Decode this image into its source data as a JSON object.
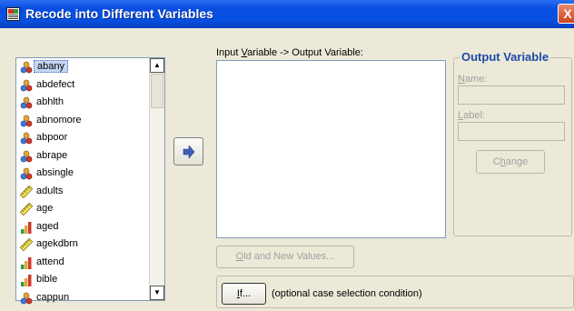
{
  "window": {
    "title": "Recode into Different Variables",
    "close_label": "X"
  },
  "source_list": {
    "items": [
      {
        "name": "abany",
        "type": "nominal",
        "selected": true
      },
      {
        "name": "abdefect",
        "type": "nominal"
      },
      {
        "name": "abhlth",
        "type": "nominal"
      },
      {
        "name": "abnomore",
        "type": "nominal"
      },
      {
        "name": "abpoor",
        "type": "nominal"
      },
      {
        "name": "abrape",
        "type": "nominal"
      },
      {
        "name": "absingle",
        "type": "nominal"
      },
      {
        "name": "adults",
        "type": "scale"
      },
      {
        "name": "age",
        "type": "scale"
      },
      {
        "name": "aged",
        "type": "ordinal"
      },
      {
        "name": "agekdbrn",
        "type": "scale"
      },
      {
        "name": "attend",
        "type": "ordinal"
      },
      {
        "name": "bible",
        "type": "ordinal"
      },
      {
        "name": "cappun",
        "type": "nominal"
      }
    ]
  },
  "mapping": {
    "label_pre": "Input ",
    "label_u": "V",
    "label_post": "ariable -> Output Variable:"
  },
  "output_variable": {
    "legend": "Output Variable",
    "name_u": "N",
    "name_rest": "ame:",
    "label_u": "L",
    "label_rest": "abel:",
    "name_value": "",
    "label_value": "",
    "change_pre": "C",
    "change_u": "h",
    "change_post": "ange"
  },
  "buttons": {
    "old_new_u": "O",
    "old_new_rest": "ld and New Values...",
    "if_u": "I",
    "if_rest": "f..."
  },
  "if_condition": {
    "text": "(optional case selection condition)"
  },
  "colors": {
    "title_bar": "#0551e3",
    "group_legend": "#1c4aa8",
    "dialog_bg": "#ece9d8",
    "selected_item": "#c6d7f5"
  }
}
